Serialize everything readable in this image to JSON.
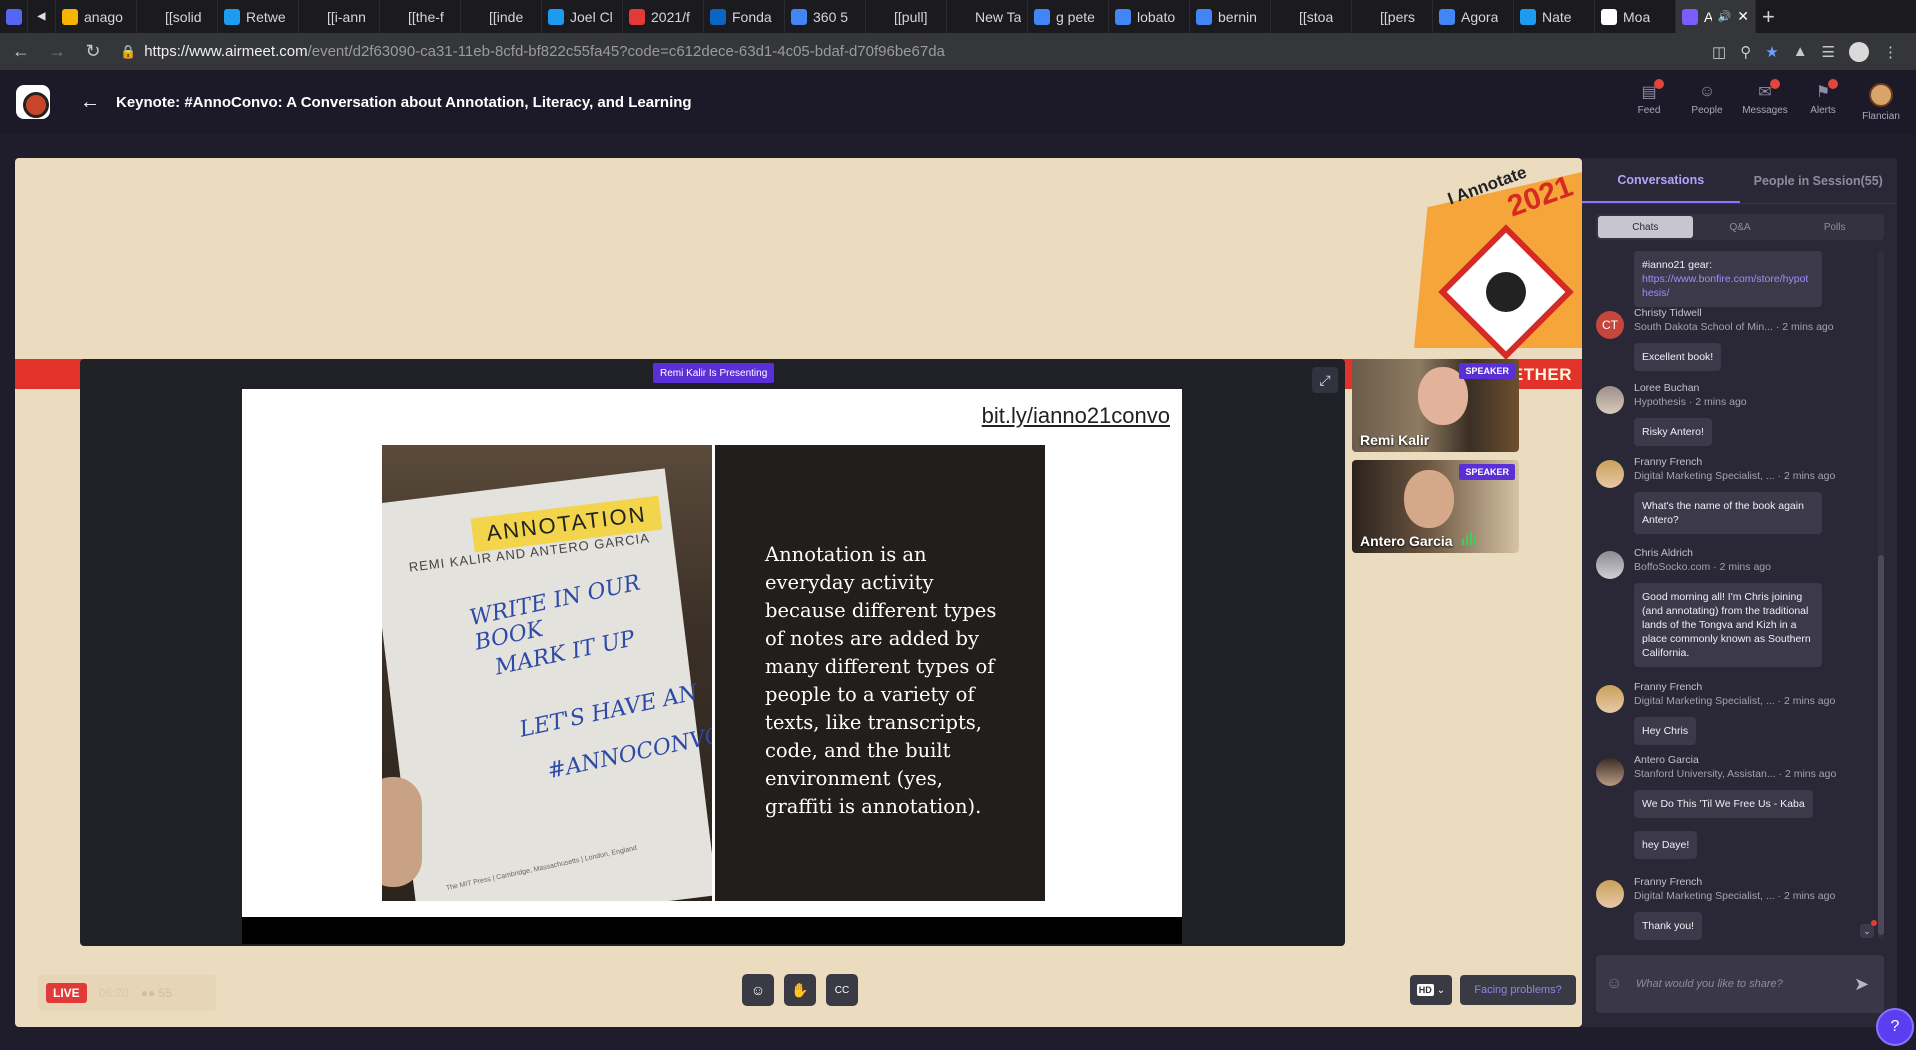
{
  "browser": {
    "tabs": [
      {
        "title": "",
        "icon": "beeper-icon",
        "color": "#5865f2"
      },
      {
        "title": "",
        "icon": "audio-icon",
        "color": "#1b1b1f"
      },
      {
        "title": "anago",
        "icon": "doc-icon",
        "color": "#f4b400"
      },
      {
        "title": "[[solid",
        "icon": "blank-icon",
        "color": "#1b1b1f"
      },
      {
        "title": "Retwe",
        "icon": "twitter-icon",
        "color": "#1d9bf0"
      },
      {
        "title": "[[i-ann",
        "icon": "blank-icon",
        "color": "#1b1b1f"
      },
      {
        "title": "[[the-f",
        "icon": "blank-icon",
        "color": "#1b1b1f"
      },
      {
        "title": "[[inde",
        "icon": "blank-icon",
        "color": "#1b1b1f"
      },
      {
        "title": "Joel Cl",
        "icon": "twitter-icon",
        "color": "#1d9bf0"
      },
      {
        "title": "2021/f",
        "icon": "calendar-icon",
        "color": "#e23a38"
      },
      {
        "title": "Fonda",
        "icon": "linkedin-icon",
        "color": "#0a66c2"
      },
      {
        "title": "360 5",
        "icon": "google-icon",
        "color": "#4285f4"
      },
      {
        "title": "[[pull]",
        "icon": "blank-icon",
        "color": "#1b1b1f"
      },
      {
        "title": "New Tab",
        "icon": "blank-icon",
        "color": "#1b1b1f"
      },
      {
        "title": "g pete",
        "icon": "google-icon",
        "color": "#4285f4"
      },
      {
        "title": "lobato",
        "icon": "google-icon",
        "color": "#4285f4"
      },
      {
        "title": "bernin",
        "icon": "google-icon",
        "color": "#4285f4"
      },
      {
        "title": "[[stoa",
        "icon": "blank-icon",
        "color": "#1b1b1f"
      },
      {
        "title": "[[pers",
        "icon": "blank-icon",
        "color": "#1b1b1f"
      },
      {
        "title": "Agora",
        "icon": "doc-icon",
        "color": "#4285f4"
      },
      {
        "title": "Nate",
        "icon": "twitter-icon",
        "color": "#1d9bf0"
      },
      {
        "title": "Moa",
        "icon": "moa-icon",
        "color": "#ffffff"
      }
    ],
    "active_tab": {
      "title": "A",
      "icon": "airmeet-icon",
      "color": "#7b5cff"
    },
    "new_tab_label": "+",
    "url_host": "https://www.airmeet.com",
    "url_path": "/event/d2f63090-ca31-11eb-8cfd-bf822c55fa45?code=c612dece-63d1-4c05-bdaf-d70f96be67da"
  },
  "header": {
    "title": "Keynote: #AnnoConvo: A Conversation about Annotation, Literacy, and Learning",
    "nav": [
      {
        "label": "Feed",
        "icon": "feed-icon",
        "has_alert": true
      },
      {
        "label": "People",
        "icon": "people-icon",
        "has_alert": false
      },
      {
        "label": "Messages",
        "icon": "messages-icon",
        "has_alert": true
      },
      {
        "label": "Alerts",
        "icon": "bell-icon",
        "has_alert": true
      },
      {
        "label": "Flancian",
        "icon": "profile-avatar",
        "has_alert": false
      }
    ]
  },
  "stage": {
    "banner_text": "GETHER",
    "brand_line": "I Annotate",
    "brand_year": "2021",
    "presenting_label": "Remi Kalir Is Presenting",
    "slide": {
      "url": "bit.ly/ianno21convo",
      "book_label": "ANNOTATION",
      "book_authors": "REMI KALIR AND ANTERO GARCIA",
      "handwriting": [
        "WRITE IN OUR BOOK",
        "MARK IT UP",
        "LET'S HAVE AN",
        "#ANNOCONVO"
      ],
      "press_text": "The MIT Press  |  Cambridge, Massachusetts  |  London, England",
      "body": "Annotation is an everyday activity because different types of notes are added by many different types of people to a variety of texts, like transcripts, code, and the built environment (yes, graffiti is annotation)."
    },
    "speakers": [
      {
        "name": "Remi Kalir",
        "badge": "SPEAKER"
      },
      {
        "name": "Antero Garcia",
        "badge": "SPEAKER"
      }
    ],
    "live_label": "LIVE",
    "live_time": "06:20",
    "viewer_count": "55",
    "hd_label": "HD",
    "problems_label": "Facing problems?"
  },
  "panel": {
    "tabs": [
      "Conversations",
      "People in Session(55)"
    ],
    "subtabs": [
      "Chats",
      "Q&A",
      "Polls"
    ],
    "messages": [
      {
        "name": "",
        "meta": "",
        "avatar": "",
        "text": "#ianno21 gear:",
        "link": "https://www.bonfire.com/store/hypothesis/"
      },
      {
        "name": "Christy Tidwell",
        "meta": "South Dakota School of Min... · 2 mins ago",
        "avatar": "CT",
        "text": "Excellent book!"
      },
      {
        "name": "Loree Buchan",
        "meta": "Hypothesis · 2 mins ago",
        "avatar": "",
        "text": "Risky Antero!"
      },
      {
        "name": "Franny French",
        "meta": "Digital Marketing Specialist, ... · 2 mins ago",
        "avatar": "",
        "text": "What's the name of the book again Antero?"
      },
      {
        "name": "Chris Aldrich",
        "meta": "BoffoSocko.com · 2 mins ago",
        "avatar": "",
        "text": "Good morning all! I'm Chris joining (and annotating) from the traditional lands of the Tongva and Kizh in a place commonly known as Southern California."
      },
      {
        "name": "Franny French",
        "meta": "Digital Marketing Specialist, ... · 2 mins ago",
        "avatar": "",
        "text": "Hey Chris"
      },
      {
        "name": "Antero Garcia",
        "meta": "Stanford University, Assistan... · 2 mins ago",
        "avatar": "",
        "text": "We Do This 'Til We Free Us - Kaba"
      },
      {
        "name": "",
        "meta": "",
        "avatar": "",
        "text": "hey Daye!"
      },
      {
        "name": "Franny French",
        "meta": "Digital Marketing Specialist, ... · 2 mins ago",
        "avatar": "",
        "text": "Thank you!"
      }
    ],
    "composer_placeholder": "What would you like to share?"
  }
}
